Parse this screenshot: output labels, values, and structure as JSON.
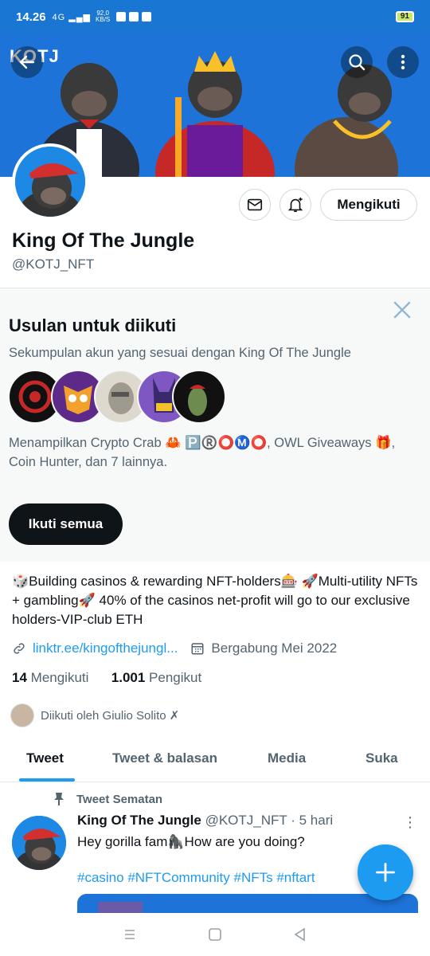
{
  "status_bar": {
    "time": "14.26",
    "signal_text": "4G",
    "speed_value": "92,0",
    "speed_unit": "KB/S",
    "battery": "91"
  },
  "banner": {
    "logo_text": "KOTJ"
  },
  "profile": {
    "name": "King Of The Jungle",
    "handle": "@KOTJ_NFT",
    "follow_button": "Mengikuti",
    "bio": "🎲Building casinos & rewarding NFT-holders🎰 🚀Multi-utility NFTs + gambling🚀 40% of the casinos net-profit will go to our exclusive holders-VIP-club ETH",
    "link": "linktr.ee/kingofthejungl...",
    "joined": "Bergabung Mei 2022",
    "following_count": "14",
    "following_label": "Mengikuti",
    "followers_count": "1.001",
    "followers_label": "Pengikut",
    "followed_by": "Diikuti oleh Giulio Solito ✗"
  },
  "suggestions": {
    "title": "Usulan untuk diikuti",
    "subtitle": "Sekumpulan akun yang sesuai dengan King Of The Jungle",
    "description": "Menampilkan Crypto Crab 🦀 🅿️®️⭕Ⓜ️⭕, OWL Giveaways 🎁, Coin Hunter, dan 7 lainnya.",
    "follow_all": "Ikuti semua"
  },
  "tabs": [
    "Tweet",
    "Tweet & balasan",
    "Media",
    "Suka"
  ],
  "pinned_tweet": {
    "pinned_label": "Tweet Sematan",
    "author_name": "King Of The Jungle",
    "author_handle": "@KOTJ_NFT",
    "time": "· 5 hari",
    "text": "Hey gorilla fam🦍How are you doing?",
    "hashtags": "#casino #NFTCommunity #NFTs #nftart"
  },
  "colors": {
    "accent": "#1d9bf0",
    "banner": "#1d73d8",
    "status_bar": "#1976d2"
  }
}
